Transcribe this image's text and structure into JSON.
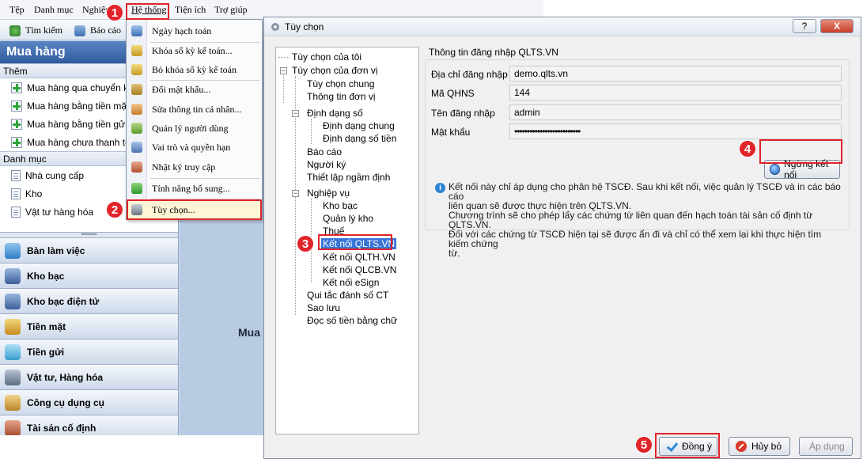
{
  "menubar": {
    "items": [
      "Tệp",
      "Danh mục",
      "Nghiệp",
      "Hệ thống",
      "Tiện ích",
      "Trợ giúp"
    ]
  },
  "toolbar": {
    "search_label": "Tìm kiếm",
    "report_label": "Báo cáo"
  },
  "sidebar": {
    "title": "Mua hàng",
    "group_add": "Thêm",
    "add_items": [
      "Mua hàng qua chuyển k",
      "Mua hàng bằng tiền mặt",
      "Mua hàng bằng tiền gửi",
      "Mua hàng chưa thanh toán"
    ],
    "group_catalog": "Danh mục",
    "catalog_items": [
      "Nhà cung cấp",
      "Kho",
      "Vật tư hàng hóa"
    ],
    "nav_buttons": [
      "Bàn làm việc",
      "Kho bạc",
      "Kho bạc điện tử",
      "Tiền mặt",
      "Tiền gửi",
      "Vật tư, Hàng hóa",
      "Công cụ dụng cụ",
      "Tài sản cố định"
    ]
  },
  "workspace": {
    "text": "Mua h"
  },
  "dropdown": {
    "items": [
      "Ngày hạch toán",
      "Khóa sổ kỳ kế toán...",
      "Bỏ khóa sổ kỳ kế toán",
      "Đổi mật khẩu...",
      "Sửa thông tin cá nhân...",
      "Quản lý người dùng",
      "Vai trò và quyền hạn",
      "Nhật ký truy cập",
      "Tính năng bổ sung...",
      "Tùy chọn..."
    ]
  },
  "dialog": {
    "title": "Tùy chọn",
    "help_label": "?",
    "close_label": "X",
    "tree": {
      "root1": "Tùy chọn của tôi",
      "root2": "Tùy chọn của đơn vị",
      "general": "Tùy chọn chung",
      "unit_info": "Thông tin đơn vị",
      "number_format": "Định dạng số",
      "general_format": "Định dạng chung",
      "money_format": "Định dạng số tiền",
      "report": "Báo cáo",
      "signer": "Người ký",
      "default_setup": "Thiết lập ngầm định",
      "business": "Nghiệp vụ",
      "treasury": "Kho bạc",
      "warehouse": "Quản lý kho",
      "tax": "Thuế",
      "qlts": "Kết nối QLTS.VN",
      "qlth": "Kết nối QLTH.VN",
      "qlcb": "Kết nối QLCB.VN",
      "esign": "Kết nối eSign",
      "numbering": "Qui tắc đánh số CT",
      "backup": "Sao lưu",
      "read_money": "Đọc số tiền bằng chữ"
    },
    "panel": {
      "header": "Thông tin đăng nhập QLTS.VN",
      "fields": [
        {
          "label": "Địa chỉ đăng nhập",
          "value": "demo.qlts.vn"
        },
        {
          "label": "Mã QHNS",
          "value": "144"
        },
        {
          "label": "Tên đăng nhập",
          "value": "admin"
        },
        {
          "label": "Mật khẩu",
          "value": "••••••••••••••••••••••••••"
        }
      ],
      "disconnect_label": "Ngừng kết nối",
      "info_lines": [
        "Kết nối này chỉ áp dụng cho phân hệ TSCĐ. Sau khi kết nối, việc quản lý TSCĐ và in các báo cáo",
        "liên quan sẽ được thực hiện trên QLTS.VN.",
        "Chương trình sẽ cho phép lấy các chứng từ liên quan đến hạch toán tài sản cố định từ QLTS.VN.",
        "Đối với các chứng từ TSCĐ hiện tại sẽ được ẩn đi và chỉ có thể xem lại khi thực hiện tìm kiếm chứng",
        "từ."
      ]
    },
    "buttons": {
      "ok": "Đồng ý",
      "cancel": "Hủy bỏ",
      "apply": "Áp dụng"
    }
  },
  "annotations": {
    "steps": [
      "1",
      "2",
      "3",
      "4",
      "5"
    ],
    "color": "#e0242a"
  }
}
